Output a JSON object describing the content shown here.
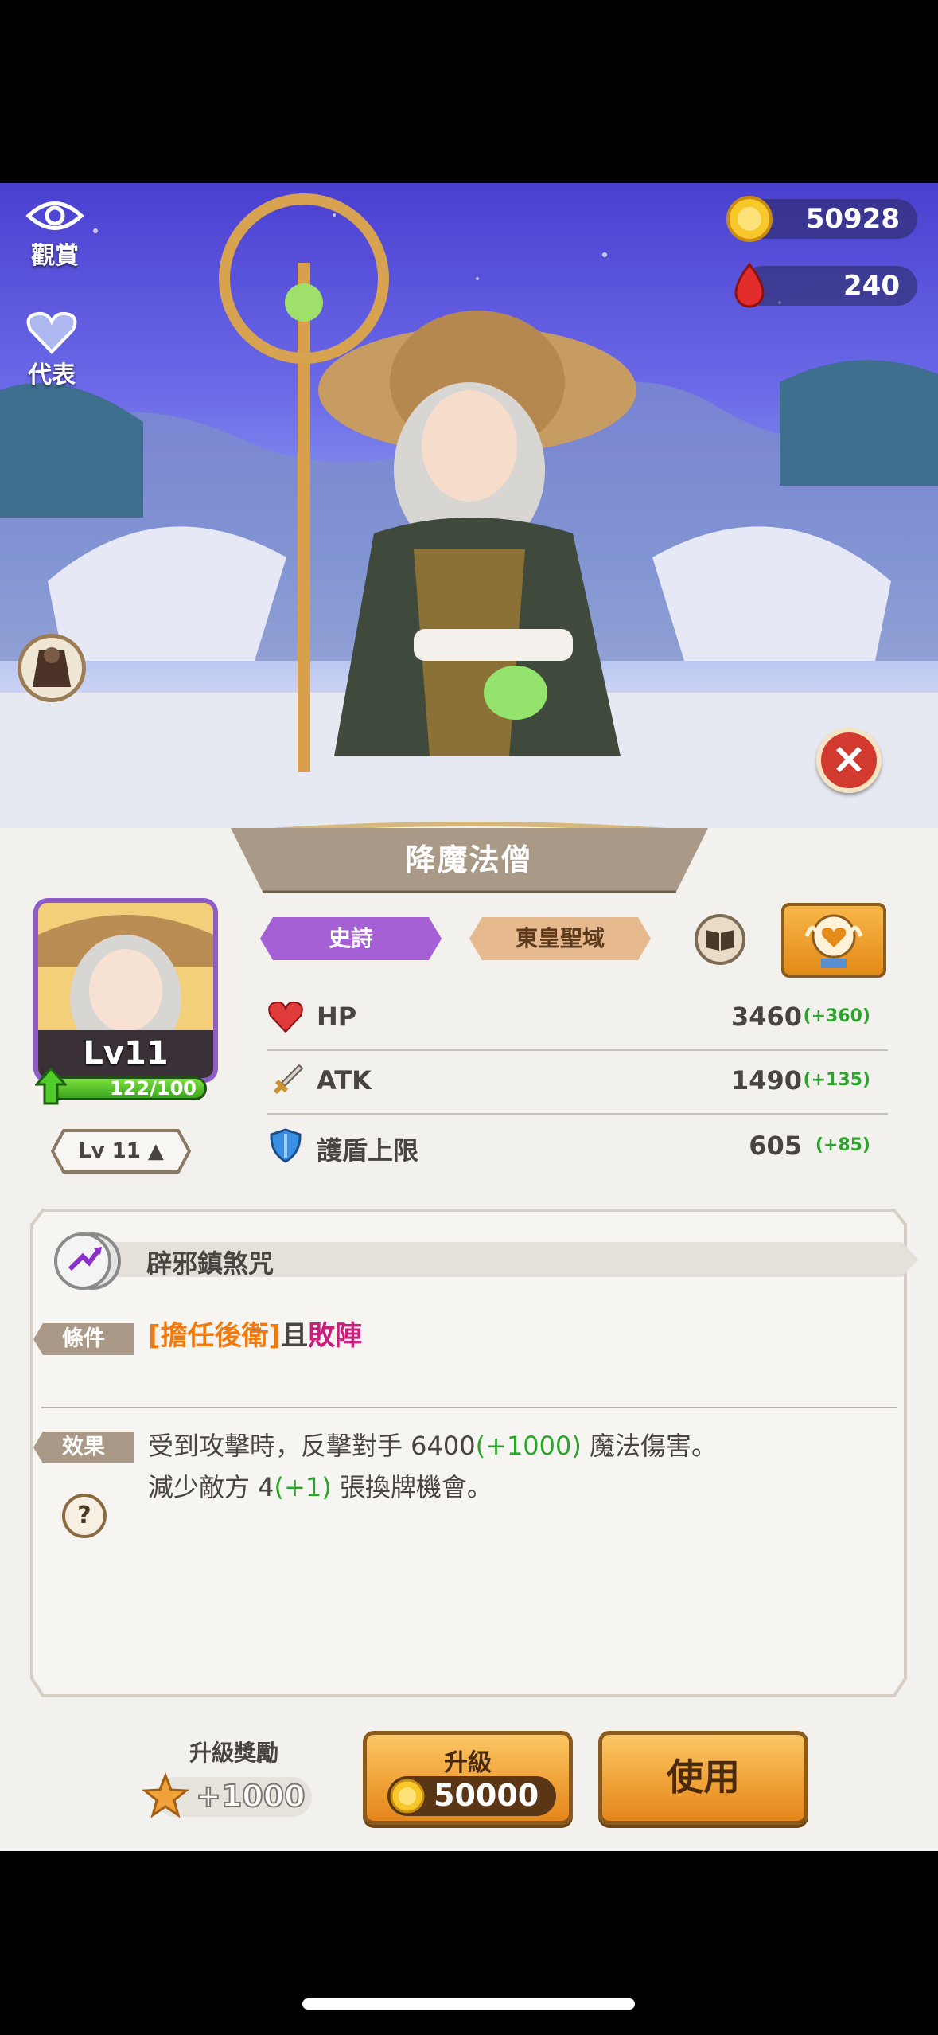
{
  "hud": {
    "view_label": "觀賞",
    "represent_label": "代表",
    "gold": "50928",
    "gems": "240"
  },
  "character": {
    "name": "降魔法僧",
    "level_label": "Lv11",
    "xp_text": "122/100",
    "xp_progress": 1.0,
    "level_button": "Lv 11 ▲",
    "rarity": "史詩",
    "region": "東皇聖域"
  },
  "stats": [
    {
      "label": "HP",
      "value": "3460",
      "bonus": "(+360)",
      "icon": "heart-icon"
    },
    {
      "label": "ATK",
      "value": "1490",
      "bonus": "(+135)",
      "icon": "sword-icon"
    },
    {
      "label": "護盾上限",
      "value": "605",
      "bonus": "(+85)",
      "icon": "shield-icon"
    }
  ],
  "skill": {
    "name": "辟邪鎮煞咒",
    "condition_label": "條件",
    "condition_part1": "[擔任後衛]",
    "condition_part2": "且",
    "condition_part3": "敗陣",
    "effect_label": "效果",
    "effect_line1_a": "受到攻擊時，反擊對手 6400",
    "effect_line1_b": "(+1000)",
    "effect_line1_c": " 魔法傷害。",
    "effect_line2_a": "減少敵方 4",
    "effect_line2_b": "(+1)",
    "effect_line2_c": " 張換牌機會。"
  },
  "footer": {
    "reward_title": "升級獎勵",
    "reward_value": "+1000",
    "upgrade_label": "升級",
    "upgrade_cost": "50000",
    "use_label": "使用"
  },
  "colors": {
    "epic": "#a560d6",
    "region": "#e7b98e",
    "bonus_green": "#2aa52a",
    "accent_orange": "#f07a0d"
  }
}
